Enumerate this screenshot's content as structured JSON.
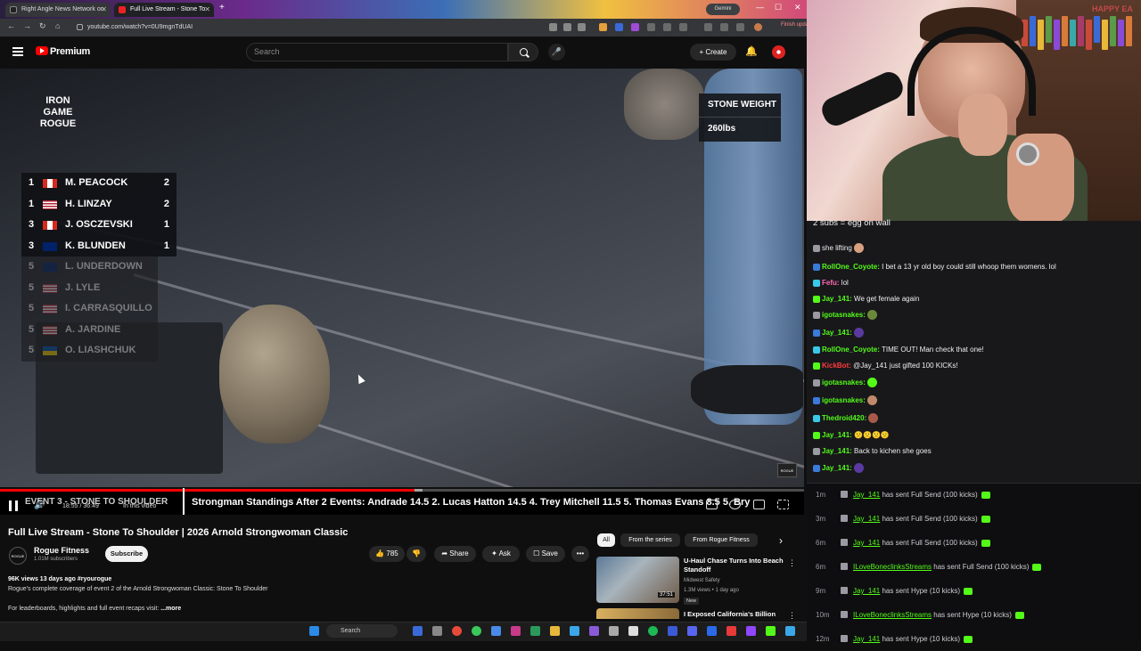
{
  "browser": {
    "tabs": [
      {
        "label": "Right Angle News Network on"
      },
      {
        "label": "Full Live Stream - Stone To"
      }
    ],
    "new_tab_label": "+",
    "gemini_label": "Gemini",
    "url": "youtube.com/watch?v=0U9mgnTdUAI",
    "finish_update_label": "Finish update",
    "window_controls": {
      "minimize": "—",
      "maximize": "☐",
      "close": "✕"
    }
  },
  "youtube": {
    "logo_text": "Premium",
    "search_placeholder": "Search",
    "mic_icon": "🎤",
    "create_label": "+ Create",
    "bell_icon": "🔔"
  },
  "video": {
    "overlay_logo": "IRON GAME\nROGUE",
    "stone_weight_label": "STONE WEIGHT",
    "stone_weight_value": "260lbs",
    "leaderboard": [
      {
        "rank": "1",
        "flag": "canada",
        "name": "M. PEACOCK",
        "score": "2",
        "active": true
      },
      {
        "rank": "1",
        "flag": "usa",
        "name": "H. LINZAY",
        "score": "2",
        "active": true
      },
      {
        "rank": "3",
        "flag": "canada",
        "name": "J. OSCZEVSKI",
        "score": "1",
        "active": true
      },
      {
        "rank": "3",
        "flag": "australia",
        "name": "K. BLUNDEN",
        "score": "1",
        "active": true
      },
      {
        "rank": "5",
        "flag": "uk",
        "name": "L. UNDERDOWN",
        "score": "",
        "active": false
      },
      {
        "rank": "5",
        "flag": "usa",
        "name": "J. LYLE",
        "score": "",
        "active": false
      },
      {
        "rank": "5",
        "flag": "usa",
        "name": "I. CARRASQUILLO",
        "score": "",
        "active": false
      },
      {
        "rank": "5",
        "flag": "usa",
        "name": "A. JARDINE",
        "score": "",
        "active": false
      },
      {
        "rank": "5",
        "flag": "ukraine",
        "name": "O. LIASHCHUK",
        "score": "",
        "active": false
      }
    ],
    "rogue_badge": "ROGUE",
    "progress_fraction": 0.515,
    "ticker_label": "EVENT 3 - STONE TO SHOULDER",
    "ticker_text": "Strongman Standings After 2 Events:    Andrade  14.5     2. Lucas Hatton  14.5     4. Trey Mitchell  11.5     5. Thomas Evans  8.5     5. Bry",
    "timecode": "18:55 / 36:49",
    "in_this_video": "In this video"
  },
  "info": {
    "title": "Full Live Stream - Stone To Shoulder | 2026 Arnold Strongwoman Classic",
    "channel_avatar_text": "ROGUE",
    "channel_name": "Rogue Fitness",
    "subscribers": "1.01M subscribers",
    "subscribe_label": "Subscribe",
    "likes": "785",
    "share_label": "Share",
    "ask_label": "Ask",
    "save_label": "Save",
    "more_label": "•••",
    "views_meta": "96K views  13 days ago  #ryourogue",
    "description": "Rogue's complete coverage of event 2 of the Arnold Strongwoman Classic: Stone To Shoulder",
    "description2": "For leaderboards, highlights and full event recaps visit:",
    "more_link": "...more"
  },
  "suggestions": {
    "chips": [
      "All",
      "From the series",
      "From Rogue Fitness"
    ],
    "next_icon": "›",
    "items": [
      {
        "title": "U-Haul Chase Turns Into Beach Standoff",
        "channel": "Midwest Safety",
        "meta": "1.3M views • 1 day ago",
        "badge": "New",
        "duration": "37:51"
      },
      {
        "title": "I Exposed California's Billion"
      }
    ]
  },
  "taskbar": {
    "search_label": "Search"
  },
  "webcam": {
    "poster_text": "HAPPY EA"
  },
  "chat": {
    "pinned": "2 subs = egg on wall",
    "messages": [
      {
        "user": "",
        "text": "she lifting",
        "user_color": "#efeff1",
        "emote": "#d9a080"
      },
      {
        "user": "RollOne_Coyote:",
        "text": " I bet a 13 yr old boy could still whoop them womens. lol",
        "user_color": "#53fc18"
      },
      {
        "user": "Fefu:",
        "text": " lol",
        "user_color": "#ff69b4"
      },
      {
        "user": "Jay_141:",
        "text": " We get female again",
        "user_color": "#53fc18"
      },
      {
        "user": "igotasnakes:",
        "text": " ",
        "user_color": "#53fc18",
        "emote": "#6a8a3a"
      },
      {
        "user": "Jay_141:",
        "text": " ",
        "user_color": "#53fc18",
        "emote": "#5a3aa0"
      },
      {
        "user": "RollOne_Coyote:",
        "text": " TIME OUT! Man check that one!",
        "user_color": "#53fc18"
      },
      {
        "user": "KickBot:",
        "text": " @Jay_141 just gifted 100 KICKs!",
        "user_color": "#ff3b3b"
      },
      {
        "user": "igotasnakes:",
        "text": " ",
        "user_color": "#53fc18",
        "emote": "#53fc18"
      },
      {
        "user": "igotasnakes:",
        "text": " ",
        "user_color": "#53fc18",
        "emote": "#c08a6a"
      },
      {
        "user": "Thedroid420:",
        "text": " ",
        "user_color": "#53fc18",
        "emote": "#a85a4a"
      },
      {
        "user": "Jay_141:",
        "text": " 🙁🙁🙁🙁",
        "user_color": "#53fc18"
      },
      {
        "user": "Jay_141:",
        "text": " Back to kichen she goes",
        "user_color": "#53fc18"
      },
      {
        "user": "Jay_141:",
        "text": " ",
        "user_color": "#53fc18",
        "emote": "#5a3aa0"
      }
    ]
  },
  "events": [
    {
      "time": "1m",
      "user": "Jay_141",
      "action": " has sent Full Send (100 kicks)"
    },
    {
      "time": "3m",
      "user": "Jay_141",
      "action": " has sent Full Send (100 kicks)"
    },
    {
      "time": "6m",
      "user": "Jay_141",
      "action": " has sent Full Send (100 kicks)"
    },
    {
      "time": "6m",
      "user": "ILoveBoneclinksStreams",
      "action": " has sent Full Send (100 kicks)"
    },
    {
      "time": "9m",
      "user": "Jay_141",
      "action": " has sent Hype (10 kicks)"
    },
    {
      "time": "10m",
      "user": "ILoveBoneclinksStreams",
      "action": " has sent Hype (10 kicks)"
    },
    {
      "time": "12m",
      "user": "Jay_141",
      "action": " has sent Hype (10 kicks)"
    }
  ],
  "colors": {
    "youtube_red": "#ff0000",
    "kick_green": "#53fc18",
    "chat_bg": "#18181b",
    "yt_bg": "#0f0f0f"
  }
}
